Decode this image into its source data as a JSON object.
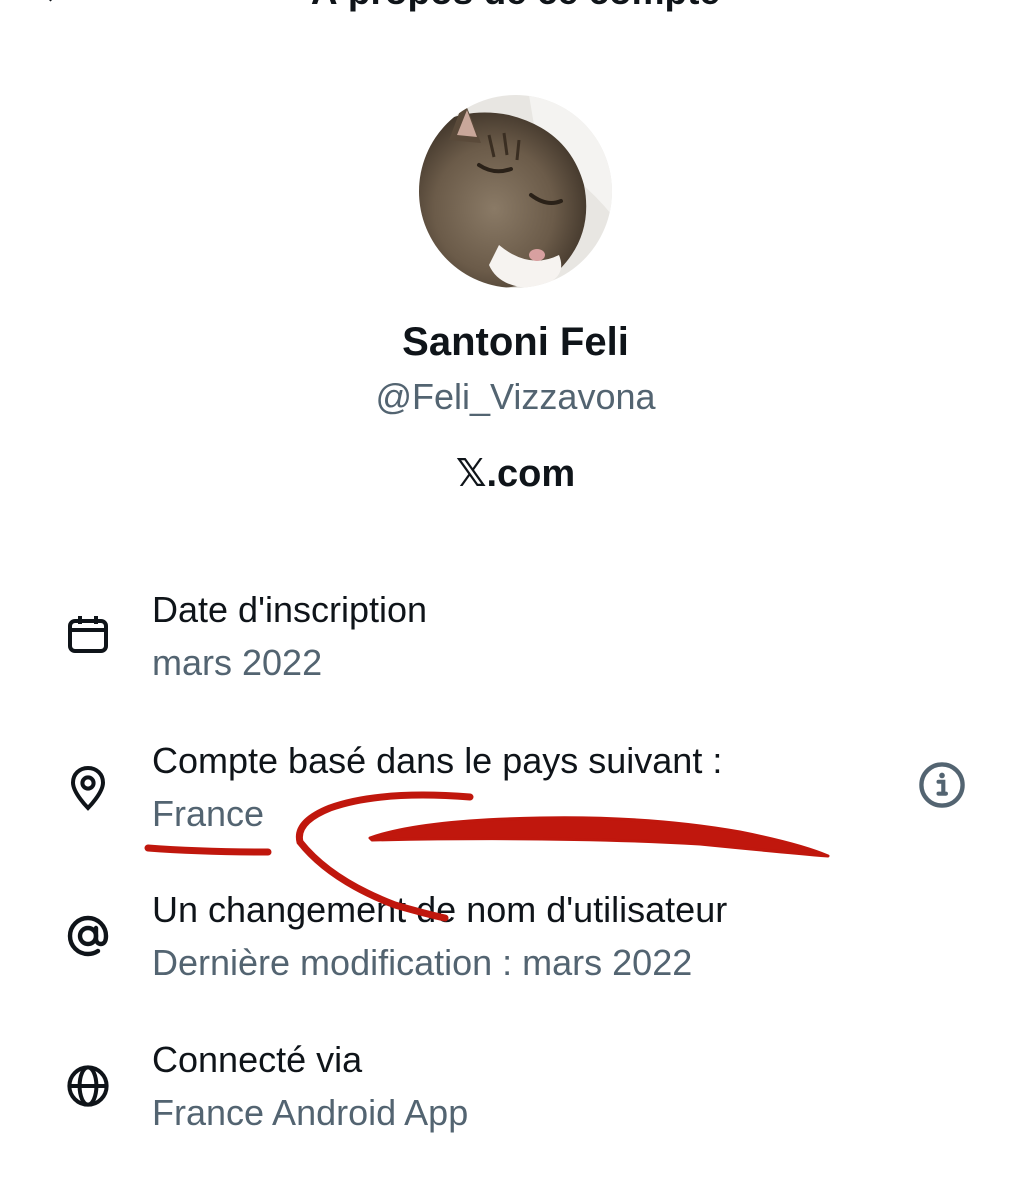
{
  "header": {
    "title": "À propos de ce compte"
  },
  "profile": {
    "display_name": "Santoni Feli",
    "handle": "@Feli_Vizzavona",
    "verified_by": "𝕏.com"
  },
  "rows": [
    {
      "icon": "calendar-icon",
      "title": "Date d'inscription",
      "value": "mars 2022"
    },
    {
      "icon": "location-pin-icon",
      "title": "Compte basé dans le pays suivant :",
      "value": "France"
    },
    {
      "icon": "at-sign-icon",
      "title": "Un changement de nom d'utilisateur",
      "value": "Dernière modification : mars 2022"
    },
    {
      "icon": "globe-icon",
      "title": "Connecté via",
      "value": "France Android App"
    }
  ],
  "colors": {
    "primary_text": "#0f1419",
    "secondary_text": "#536471",
    "annotation_red": "#c0170d"
  }
}
